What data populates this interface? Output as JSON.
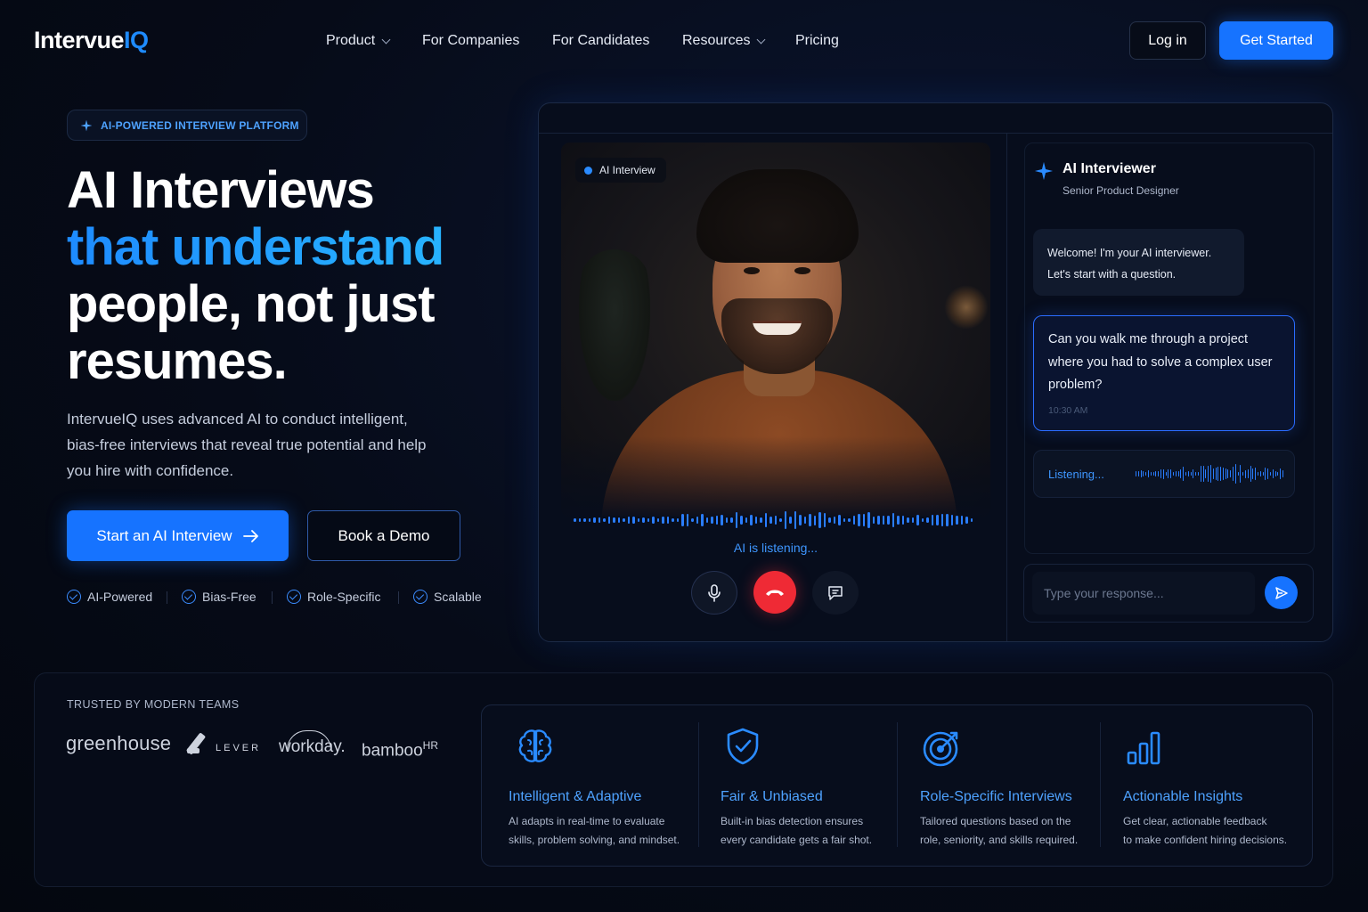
{
  "nav": {
    "logo_main": "Intervue",
    "logo_accent": "IQ",
    "items": [
      {
        "label": "Product",
        "dropdown": true
      },
      {
        "label": "For Companies",
        "dropdown": false
      },
      {
        "label": "For Candidates",
        "dropdown": false
      },
      {
        "label": "Resources",
        "dropdown": true
      },
      {
        "label": "Pricing",
        "dropdown": false
      }
    ],
    "login_label": "Log in",
    "get_started_label": "Get Started"
  },
  "hero": {
    "badge": "AI-POWERED INTERVIEW PLATFORM",
    "title_line1": "AI Interviews",
    "title_line2": "that understand",
    "title_line3": "people, not just",
    "title_line4": "resumes.",
    "lead": "IntervueIQ uses advanced AI to conduct intelligent, bias-free interviews that reveal true potential and help you hire with confidence.",
    "cta_primary": "Start an AI Interview",
    "cta_secondary": "Book a Demo",
    "features": [
      "AI-Powered",
      "Bias-Free",
      "Role-Specific",
      "Scalable"
    ]
  },
  "interview": {
    "video_tag": "AI Interview",
    "listening_text": "AI is listening...",
    "interviewer_title": "AI Interviewer",
    "interviewer_role": "Senior Product Designer",
    "welcome_line1": "Welcome! I'm your AI interviewer.",
    "welcome_line2": "Let's start with a question.",
    "question": "Can you walk me through a project where you had to solve a complex user problem?",
    "question_time": "10:30 AM",
    "listening_label": "Listening...",
    "input_placeholder": "Type your response..."
  },
  "bottom": {
    "trusted_label": "TRUSTED BY MODERN TEAMS",
    "logos": {
      "greenhouse": "greenhouse",
      "lever": "LEVER",
      "workday": "workday.",
      "bamboo_main": "bamboo",
      "bamboo_sup": "HR"
    },
    "features": [
      {
        "icon": "brain-icon",
        "title": "Intelligent & Adaptive",
        "desc_line1": "AI adapts in real-time to evaluate",
        "desc_line2": "skills, problem solving, and mindset."
      },
      {
        "icon": "shield-check-icon",
        "title": "Fair & Unbiased",
        "desc_line1": "Built-in bias detection ensures",
        "desc_line2": "every candidate gets a fair shot."
      },
      {
        "icon": "target-icon",
        "title": "Role-Specific Interviews",
        "desc_line1": "Tailored questions based on the",
        "desc_line2": "role, seniority, and skills required."
      },
      {
        "icon": "bar-chart-icon",
        "title": "Actionable Insights",
        "desc_line1": "Get clear, actionable feedback",
        "desc_line2": "to make confident hiring decisions."
      }
    ]
  },
  "colors": {
    "accent": "#1673ff",
    "accent_light": "#4ea2ff",
    "background": "#060b18",
    "end_call": "#ef2a35"
  }
}
